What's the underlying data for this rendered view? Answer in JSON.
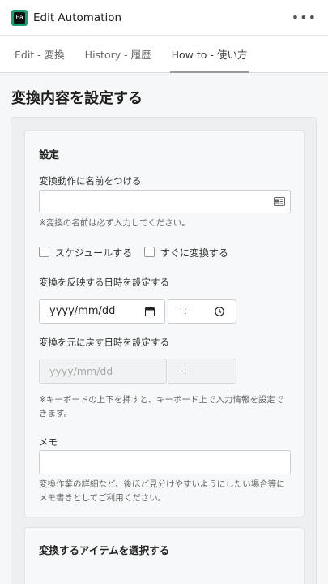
{
  "app": {
    "logo_text": "Ea",
    "title": "Edit Automation",
    "more_label": "•••"
  },
  "tabs": [
    {
      "label": "Edit - 変換"
    },
    {
      "label": "History - 履歴"
    },
    {
      "label": "How to - 使い方"
    }
  ],
  "page": {
    "title": "変換内容を設定する"
  },
  "settings": {
    "title": "設定",
    "name_label": "変換動作に名前をつける",
    "name_value": "",
    "name_hint": "※変換の名前は必ず入力してください。",
    "schedule_label": "スケジュールする",
    "immediate_label": "すぐに変換する",
    "apply_label": "変換を反映する日時を設定する",
    "apply_date_placeholder": "yyyy/mm/dd",
    "apply_time_placeholder": "--:--",
    "revert_label": "変換を元に戻す日時を設定する",
    "revert_date_placeholder": "yyyy/mm/dd",
    "revert_time_placeholder": "--:--",
    "keyboard_hint": "※キーボードの上下を押すと、キーボード上で入力情報を設定できます。",
    "memo_label": "メモ",
    "memo_value": "",
    "memo_hint": "変換作業の詳細など、後ほど見分けやすいようにしたい場合等にメモ書きとしてご利用ください。"
  },
  "items_section": {
    "title": "変換するアイテムを選択する"
  },
  "colors": {
    "brand": "#1d9e74",
    "background": "#f6f7f8"
  }
}
